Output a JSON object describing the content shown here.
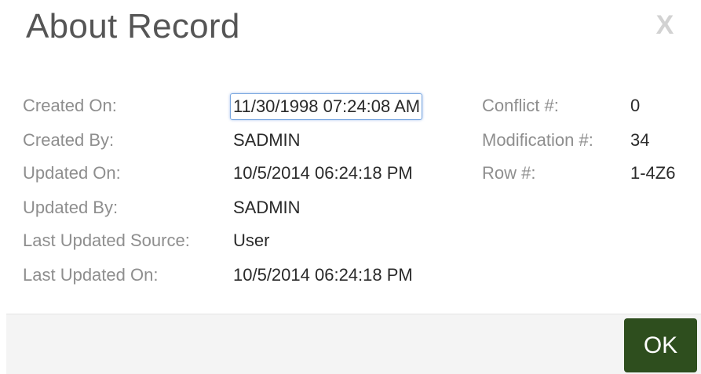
{
  "dialog": {
    "title": "About Record",
    "close_label": "X"
  },
  "left_fields": [
    {
      "label": "Created On:",
      "value": "11/30/1998 07:24:08 AM"
    },
    {
      "label": "Created By:",
      "value": "SADMIN"
    },
    {
      "label": "Updated On:",
      "value": "10/5/2014 06:24:18 PM"
    },
    {
      "label": "Updated By:",
      "value": "SADMIN"
    },
    {
      "label": "Last Updated Source:",
      "value": "User"
    },
    {
      "label": "Last Updated On:",
      "value": "10/5/2014 06:24:18 PM"
    }
  ],
  "right_fields": [
    {
      "label": "Conflict #:",
      "value": "0"
    },
    {
      "label": "Modification #:",
      "value": "34"
    },
    {
      "label": "Row #:",
      "value": "1-4Z6"
    }
  ],
  "footer": {
    "ok_label": "OK"
  },
  "colors": {
    "ok_button": "#2e4e1e",
    "label_text": "#8e8e8e",
    "value_text": "#2a2a2a",
    "focus_ring": "#7aa7e0"
  }
}
